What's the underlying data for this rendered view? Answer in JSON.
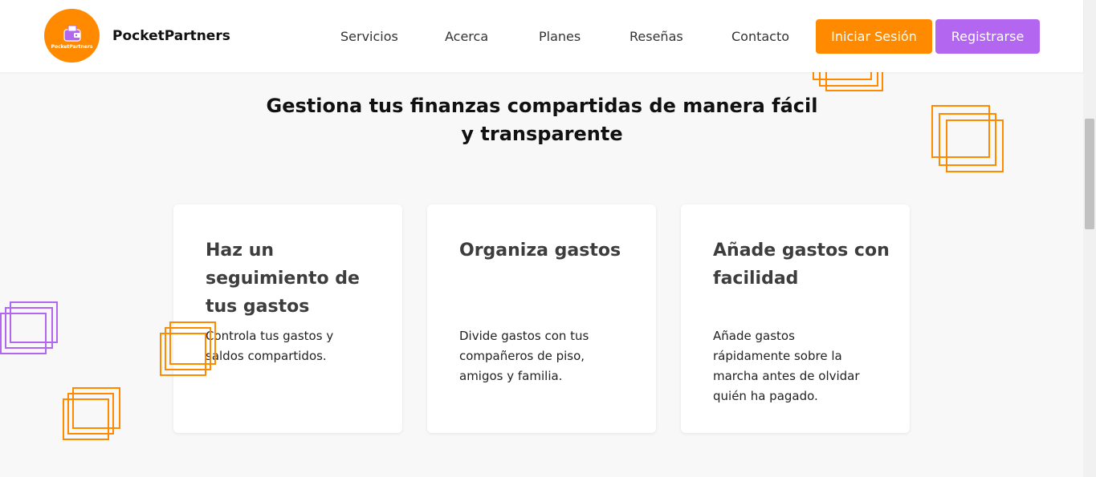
{
  "header": {
    "brand": "PocketPartners",
    "logo_caption": "PocketPartners",
    "nav": [
      "Servicios",
      "Acerca",
      "Planes",
      "Reseñas",
      "Contacto"
    ],
    "login_label": "Iniciar Sesión",
    "register_label": "Registrarse"
  },
  "hero": {
    "headline": "Gestiona tus finanzas compartidas de manera fácil y transparente"
  },
  "cards": [
    {
      "title": "Haz un seguimiento de tus gastos",
      "text": "Controla tus gastos y saldos compartidos."
    },
    {
      "title": "Organiza gastos",
      "text": "Divide gastos con tus compañeros de piso, amigos y familia."
    },
    {
      "title": "Añade gastos con facilidad",
      "text": "Añade gastos rápidamente sobre la marcha antes de olvidar quién ha pagado."
    }
  ],
  "colors": {
    "accent_orange": "#ff8a00",
    "accent_purple": "#b366f0",
    "background": "#f8f8f8"
  }
}
